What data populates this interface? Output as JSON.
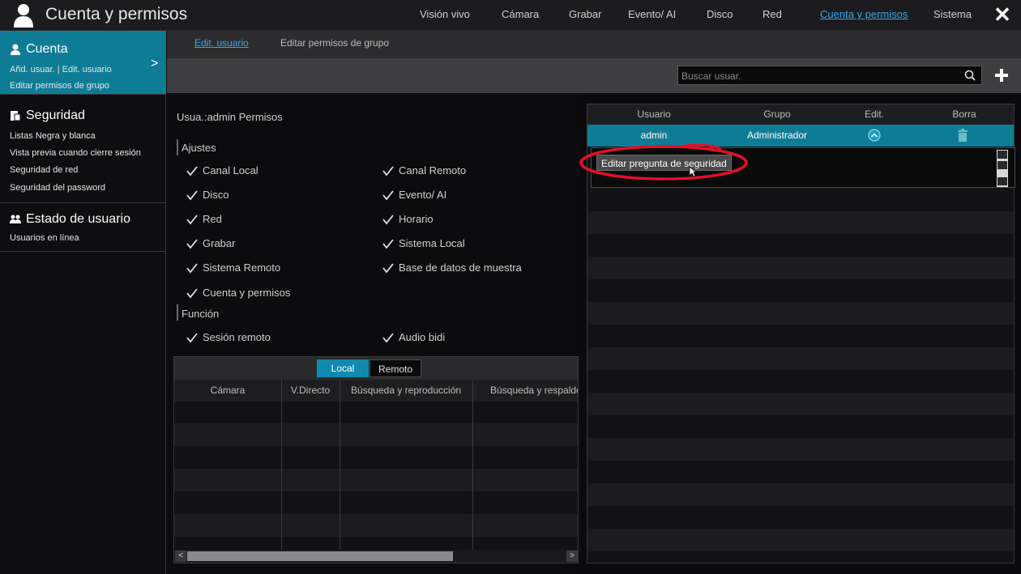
{
  "app": {
    "title": "Cuenta y permisos",
    "icon": "user-icon"
  },
  "topnav": {
    "items": [
      {
        "label": "Visión vivo",
        "active": false
      },
      {
        "label": "Cámara",
        "active": false
      },
      {
        "label": "Grabar",
        "active": false
      },
      {
        "label": "Evento/ AI",
        "active": false
      },
      {
        "label": "Disco",
        "active": false
      },
      {
        "label": "Red",
        "active": false
      },
      {
        "label": "Cuenta y permisos",
        "active": true
      },
      {
        "label": "Sistema",
        "active": false
      }
    ],
    "close_icon": "close-icon"
  },
  "sidebar": {
    "cuenta": {
      "label": "Cuenta",
      "sub1": "Añd. usuar.",
      "sub1_sep": "|",
      "sub2": "Edit. usuario",
      "sub3": "Editar permisos de grupo"
    },
    "seguridad": {
      "label": "Seguridad",
      "items": [
        "Listas Negra y blanca",
        "Vista previa cuando cierre sesión",
        "Seguridad de red",
        "Seguridad del password"
      ]
    },
    "estado": {
      "label": "Estado de usuario",
      "items": [
        "Usuarios en línea"
      ]
    }
  },
  "subtabs": {
    "items": [
      {
        "label": "Edit. usuario",
        "active": true
      },
      {
        "label": "Editar permisos de grupo",
        "active": false
      }
    ]
  },
  "search": {
    "placeholder": "Buscar usuar.",
    "value": ""
  },
  "permissions": {
    "title": "Usua.:admin Permisos",
    "section_ajustes": "Ajustes",
    "ajustes": [
      "Canal Local",
      "Canal Remoto",
      "Disco",
      "Evento/ AI",
      "Red",
      "Horario",
      "Grabar",
      "Sistema Local",
      "Sistema Remoto",
      "Base de datos de muestra",
      "Cuenta y permisos"
    ],
    "section_funcion": "Función",
    "funcion": [
      "Sesión remoto",
      "Audio bidi"
    ]
  },
  "camera_table": {
    "tabs": [
      {
        "label": "Local",
        "active": true
      },
      {
        "label": "Remoto",
        "active": false
      }
    ],
    "columns": [
      "Cámara",
      "V.Directo",
      "Búsqueda y reproducción",
      "Búsqueda y respaldo"
    ],
    "rows": []
  },
  "users_table": {
    "columns": [
      "Usuario",
      "Grupo",
      "Edit.",
      "Borra"
    ],
    "rows": [
      {
        "usuario": "admin",
        "grupo": "Administrador",
        "selected": true
      }
    ],
    "dropdown_item": "Editar pregunta de seguridad"
  },
  "colors": {
    "accent": "#0f7c95",
    "active_link": "#3ba6e8",
    "highlight_ring": "#e0112a"
  }
}
